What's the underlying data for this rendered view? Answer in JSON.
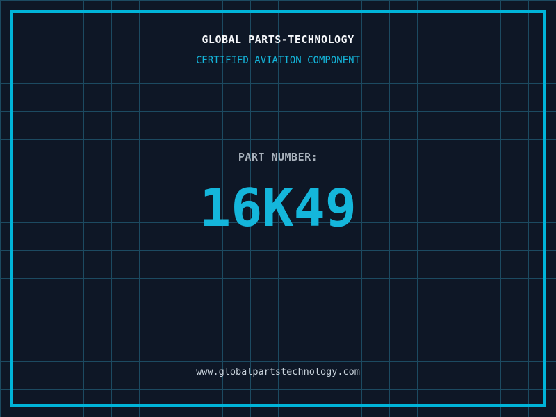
{
  "theme": {
    "background": "#0e1726",
    "grid_line": "#1c4a61",
    "frame_border": "#00b4d9",
    "accent_cyan": "#14b6db",
    "title_white": "#f5f7fa",
    "label_gray": "#a9b2bc",
    "url_gray": "#c9d3dc"
  },
  "header": {
    "company_name": "GLOBAL PARTS-TECHNOLOGY",
    "tagline": "CERTIFIED AVIATION COMPONENT"
  },
  "part": {
    "label": "PART NUMBER:",
    "number": "16K49"
  },
  "footer": {
    "website_url": "www.globalpartstechnology.com"
  }
}
